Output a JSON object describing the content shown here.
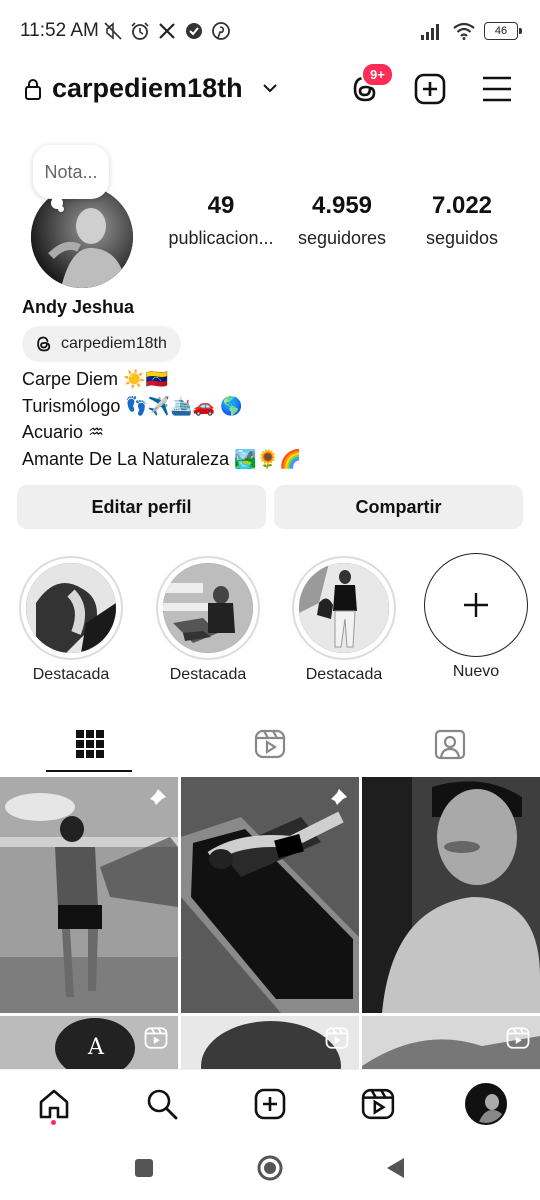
{
  "status_bar": {
    "time": "11:52 AM",
    "battery": "46",
    "left_icons": [
      "mute-icon",
      "alarm-icon",
      "x-icon",
      "check-icon",
      "pinterest-icon"
    ],
    "right_icons": [
      "signal-icon",
      "wifi-icon",
      "battery-icon"
    ]
  },
  "header": {
    "username": "carpediem18th",
    "threads_badge": "9+"
  },
  "profile": {
    "note": "Nota...",
    "stats": [
      {
        "value": "49",
        "label": "publicacion..."
      },
      {
        "value": "4.959",
        "label": "seguidores"
      },
      {
        "value": "7.022",
        "label": "seguidos"
      }
    ],
    "full_name": "Andy Jeshua",
    "threads_handle": "carpediem18th",
    "bio": [
      "Carpe Diem ☀️🇻🇪",
      "Turismólogo 👣✈️🛳️🚗 🌎",
      "Acuario ♒",
      "Amante De La Naturaleza 🏞️🌻🌈"
    ]
  },
  "actions": {
    "edit": "Editar perfil",
    "share": "Compartir"
  },
  "highlights": [
    {
      "label": "Destacada"
    },
    {
      "label": "Destacada"
    },
    {
      "label": "Destacada"
    },
    {
      "label": "Nuevo"
    }
  ],
  "tabs": [
    "grid-icon",
    "reels-icon",
    "tagged-icon"
  ],
  "colors": {
    "badge": "#ff2d55",
    "button_bg": "#efeff0",
    "text": "#111111"
  }
}
